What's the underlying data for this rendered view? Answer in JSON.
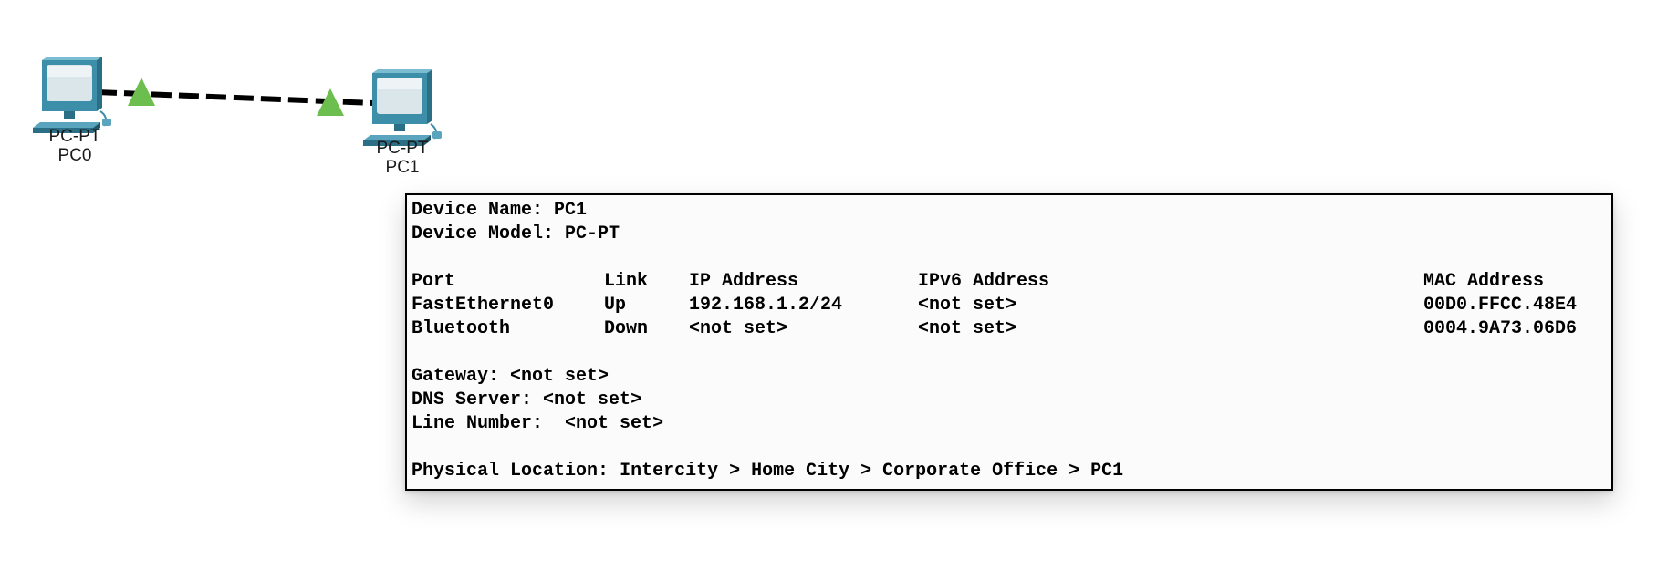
{
  "topology": {
    "devices": [
      {
        "model": "PC-PT",
        "name": "PC0"
      },
      {
        "model": "PC-PT",
        "name": "PC1"
      }
    ],
    "link": {
      "status_color": "#6cbf4f",
      "cable_color": "#000000"
    },
    "device_color": "#3d8ea8"
  },
  "tooltip": {
    "device_name_label": "Device Name:",
    "device_name": "PC1",
    "device_model_label": "Device Model:",
    "device_model": "PC-PT",
    "table": {
      "headers": {
        "port": "Port",
        "link": "Link",
        "ip": "IP Address",
        "ipv6": "IPv6 Address",
        "mac": "MAC Address"
      },
      "rows": [
        {
          "port": "FastEthernet0",
          "link": "Up",
          "ip": "192.168.1.2/24",
          "ipv6": "<not set>",
          "mac": "00D0.FFCC.48E4"
        },
        {
          "port": "Bluetooth",
          "link": "Down",
          "ip": "<not set>",
          "ipv6": "<not set>",
          "mac": "0004.9A73.06D6"
        }
      ]
    },
    "gateway_label": "Gateway:",
    "gateway": "<not set>",
    "dns_label": "DNS Server:",
    "dns": "<not set>",
    "line_number_label": "Line Number:",
    "line_number": "<not set>",
    "location_label": "Physical Location:",
    "location": "Intercity > Home City > Corporate Office > PC1"
  }
}
